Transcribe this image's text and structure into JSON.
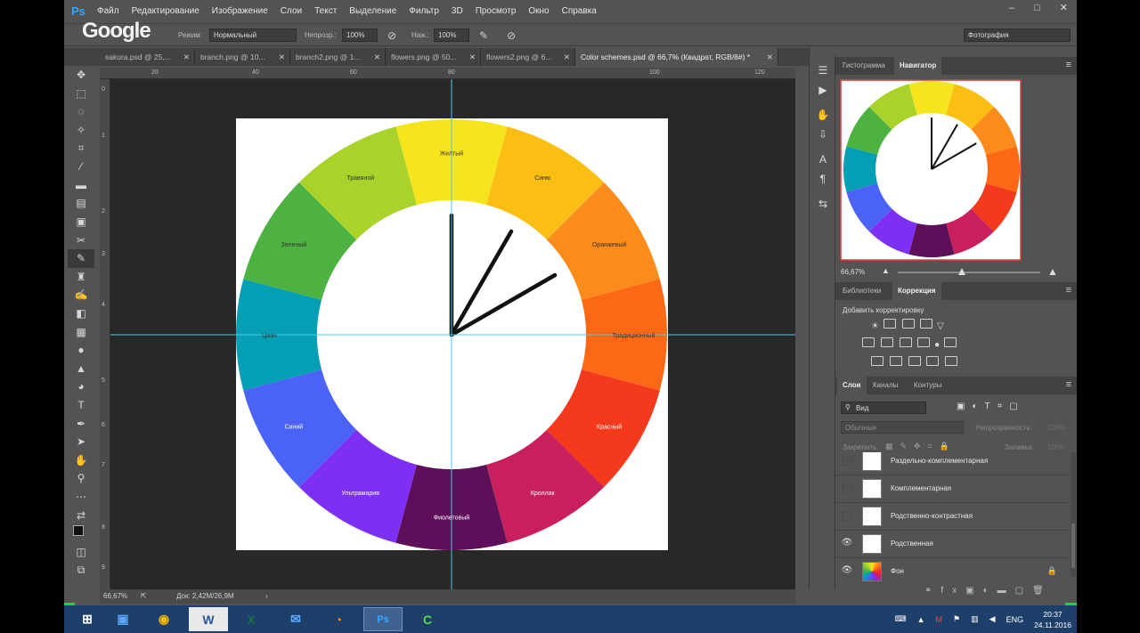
{
  "app": {
    "logo": "Ps",
    "watermark": "Google"
  },
  "menu": [
    "Файл",
    "Редактирование",
    "Изображение",
    "Слои",
    "Текст",
    "Выделение",
    "Фильтр",
    "3D",
    "Просмотр",
    "Окно",
    "Справка"
  ],
  "window_controls": {
    "minimize": "–",
    "maximize": "□",
    "close": "✕"
  },
  "options_bar": {
    "mode_label": "Режим:",
    "mode_value": "Нормальный",
    "opacity_label": "Непрозр.:",
    "opacity_value": "100%",
    "pressure_label": "Наж.:",
    "pressure_value": "100%",
    "workspace": "Фотография"
  },
  "tabs": [
    {
      "label": "sakura.psd @ 25,...",
      "active": false
    },
    {
      "label": "branch.png @ 10...",
      "active": false
    },
    {
      "label": "branch2.png @ 1...",
      "active": false
    },
    {
      "label": "flowers.png @ 50...",
      "active": false
    },
    {
      "label": "flowers2.png @ 6...",
      "active": false
    },
    {
      "label": "Color schemes.psd @ 66,7% (Квадрат, RGB/8#) *",
      "active": true
    }
  ],
  "ruler_top": [
    "20",
    "40",
    "60",
    "80",
    "100",
    "120"
  ],
  "ruler_left": [
    "0",
    "1",
    "2",
    "3",
    "4",
    "5",
    "6",
    "7",
    "8",
    "9"
  ],
  "document": {
    "segments": [
      {
        "label": "Желтый",
        "color": "#f6e51d"
      },
      {
        "label": "Синю",
        "color": "#fbbe12"
      },
      {
        "label": "Оранжевый",
        "color": "#fb8b1b"
      },
      {
        "label": "Традиционный",
        "color": "#fc6814"
      },
      {
        "label": "Красный",
        "color": "#f5391c"
      },
      {
        "label": "Кроллак",
        "color": "#c91f5d"
      },
      {
        "label": "Фиолетовый",
        "color": "#5d0f59"
      },
      {
        "label": "Ультрамария",
        "color": "#7d2ff3"
      },
      {
        "label": "Синий",
        "color": "#4a62f5"
      },
      {
        "label": "Циан",
        "color": "#049fb4"
      },
      {
        "label": "Зеленый",
        "color": "#4db241"
      },
      {
        "label": "Травяной",
        "color": "#a9d22a"
      }
    ],
    "hand_angles_deg": [
      0,
      30,
      60
    ],
    "guide_color": "#4ec9e8"
  },
  "status_bar": {
    "zoom": "66,67%",
    "doc": "Док: 2,42M/26,9M"
  },
  "right_panel": {
    "top_tabs": [
      "Гистограмма",
      "Навигатор"
    ],
    "navigator_zoom": "66,67%",
    "mid_tabs": [
      "Библиотеки",
      "Коррекция"
    ],
    "correction_title": "Добавить корректировку",
    "layer_tabs": [
      "Слои",
      "Каналы",
      "Контуры"
    ],
    "layer_filter": "Вид",
    "blend_mode": "Обычные",
    "opacity_label": "Непрозрачность:",
    "opacity_value": "100%",
    "lock_label": "Закрепить:",
    "fill_label": "Заливка:",
    "fill_value": "100%",
    "layers": [
      {
        "name": "Раздельно-комплементарная",
        "visible": false,
        "locked": false
      },
      {
        "name": "Комплементарная",
        "visible": false,
        "locked": false
      },
      {
        "name": "Родственно-контрастная",
        "visible": false,
        "locked": false
      },
      {
        "name": "Родственная",
        "visible": true,
        "locked": false
      },
      {
        "name": "Фон",
        "visible": true,
        "locked": true
      }
    ]
  },
  "taskbar": {
    "apps": [
      "explorer",
      "chrome",
      "word",
      "excel",
      "thunderbird",
      "firefox",
      "photoshop",
      "camtasia"
    ],
    "lang": "ENG",
    "time": "20:37",
    "date": "24.11.2016"
  }
}
